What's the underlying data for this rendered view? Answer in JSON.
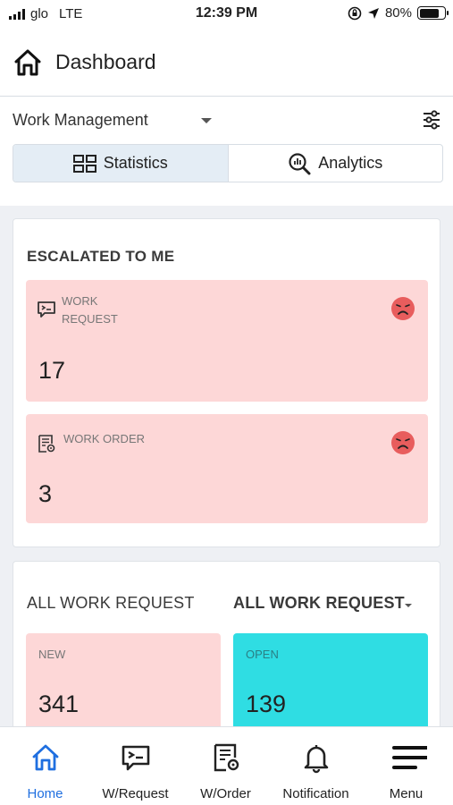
{
  "status_bar": {
    "carrier": "glo",
    "network": "LTE",
    "time": "12:39 PM",
    "battery": "80%",
    "battery_level": 0.8
  },
  "header": {
    "title": "Dashboard"
  },
  "module": {
    "selected": "Work Management"
  },
  "tabs": {
    "statistics": "Statistics",
    "analytics": "Analytics"
  },
  "escalated": {
    "title": "ESCALATED TO ME",
    "work_request": {
      "label_line1": "WORK",
      "label_line2": "REQUEST",
      "value": "17"
    },
    "work_order": {
      "label": "WORK ORDER",
      "value": "3"
    }
  },
  "all_work_request": {
    "title": "ALL WORK REQUEST",
    "dropdown": "ALL WORK REQUEST",
    "new": {
      "label": "NEW",
      "value": "341"
    },
    "open": {
      "label": "OPEN",
      "value": "139"
    }
  },
  "bottom_nav": {
    "home": "Home",
    "w_request": "W/Request",
    "w_order": "W/Order",
    "notification": "Notification",
    "menu": "Menu",
    "active": "home"
  },
  "colors": {
    "accent": "#1f6fe0",
    "escalated_tile": "#fdd7d7",
    "open_tile": "#2fdde3",
    "sad_face": "#e85d5d"
  }
}
